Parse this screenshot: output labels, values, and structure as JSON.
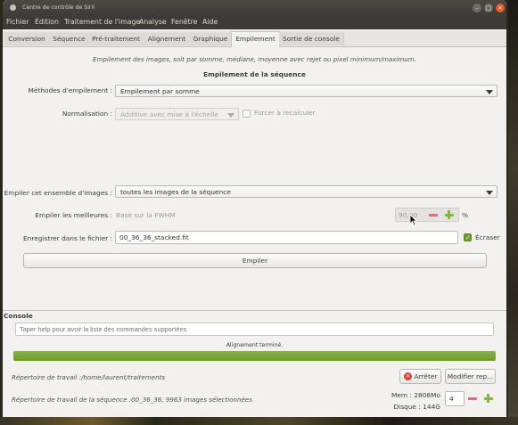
{
  "window": {
    "title": "Centre de contrôle de Siril",
    "buttons": {
      "minimize": "–",
      "maximize": "□",
      "close": "×"
    }
  },
  "menu": [
    "Fichier",
    "Édition",
    "Traitement de l'image",
    "Analyse",
    "Fenêtre",
    "Aide"
  ],
  "tabs": [
    "Conversion",
    "Séquence",
    "Pré-traitement",
    "Alignement",
    "Graphique",
    "Empilement",
    "Sortie de console"
  ],
  "active_tab": "Empilement",
  "stacking": {
    "description": "Empilement des images, soit par somme, médiane, moyenne avec rejet ou pixel minimum/maximum.",
    "section_title": "Empilement de la séquence",
    "method_label": "Méthodes d'empilement :",
    "method_value": "Empilement par somme",
    "normalisation_label": "Normalisation :",
    "normalisation_value": "Additive avec mise à l'échelle",
    "force_recalc_label": "Forcer à recalculer",
    "stack_set_label": "Empiler cet ensemble d'images :",
    "stack_set_value": "toutes les images de la séquence",
    "best_label": "Empiler les meilleures :",
    "best_hint": "Basé sur la FWHM",
    "best_percent_value": "90,00",
    "percent_unit": "%",
    "save_label": "Enregistrer dans le fichier :",
    "save_filename": "00_36_36_stacked.fit",
    "overwrite_label": "Écraser",
    "overwrite_checked": true,
    "stack_button": "Empiler"
  },
  "console": {
    "title": "Console",
    "placeholder": "Taper help pour avoir la liste des commandes supportées",
    "progress_text": "Alignement terminé.",
    "progress_fraction": 1.0,
    "working_dir": "Répertoire de travail :/home/laurent/traitements",
    "stop_button": "Arrêter",
    "modify_button": "Modifier rep...",
    "sequence_dir": "Répertoire de travail de la séquence :00_36_36, 9963 images sélectionnées",
    "mem": "Mem : 2808Mo",
    "disk": "Disque : 144G",
    "threads": "4"
  },
  "colors": {
    "accent_green": "#6f9d2d",
    "stop_red": "#d94032",
    "close_orange": "#e9592d"
  }
}
